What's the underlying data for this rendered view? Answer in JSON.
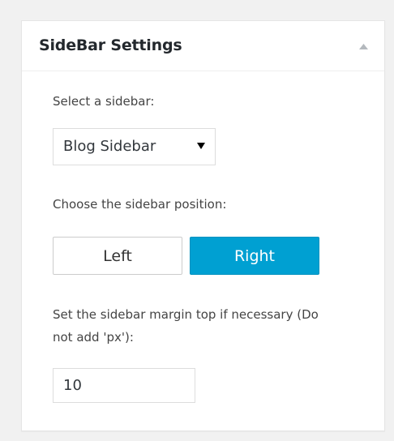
{
  "panel": {
    "title": "SideBar Settings",
    "collapse_icon": "triangle-up-icon"
  },
  "sidebar_select": {
    "label": "Select a sidebar:",
    "selected_value": "Blog Sidebar",
    "arrow_icon": "triangle-down-icon"
  },
  "position": {
    "label": "Choose the sidebar position:",
    "options": [
      {
        "label": "Left",
        "selected": false
      },
      {
        "label": "Right",
        "selected": true
      }
    ]
  },
  "margin_top": {
    "label": "Set the sidebar margin top if necessary (Do not add 'px'):",
    "value": "10"
  },
  "colors": {
    "accent": "#00a0d2",
    "background": "#f1f1f1",
    "panel": "#ffffff"
  }
}
